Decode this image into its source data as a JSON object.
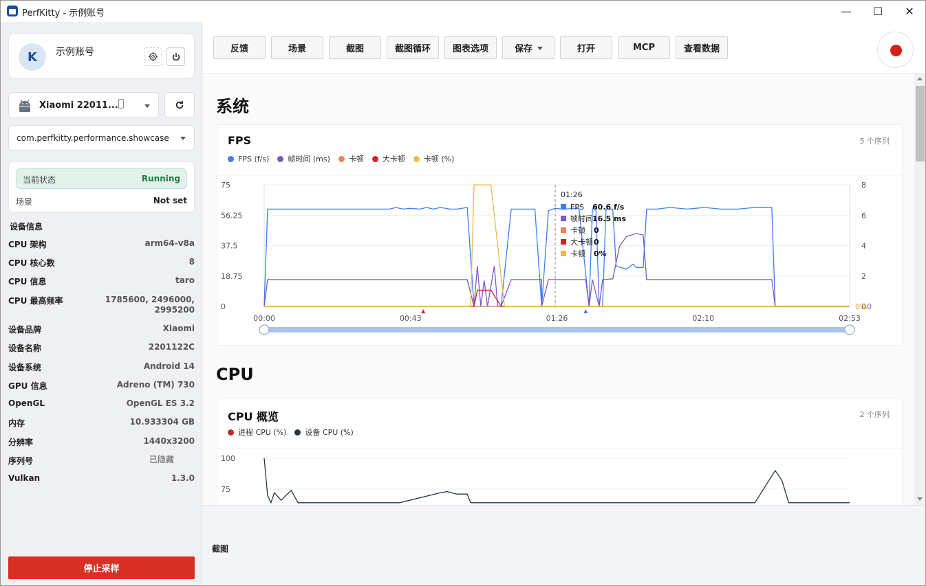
{
  "window": {
    "title": "PerfKitty - 示例账号",
    "minimize": "—",
    "maximize": "☐",
    "close": "✕"
  },
  "account": {
    "initial": "K",
    "name": "示例账号",
    "settings_icon": "gear-icon",
    "power_icon": "power-icon"
  },
  "device": {
    "name": "Xiaomi 22011...",
    "icon": "android-icon",
    "refresh_icon": "refresh-icon"
  },
  "package": {
    "name": "com.perfkitty.performance.showcase"
  },
  "status": {
    "label": "当前状态",
    "value": "Running",
    "scene_label": "场景",
    "scene_value": "Not set",
    "running_color": "#1e7d45"
  },
  "device_info": {
    "heading": "设备信息",
    "items": [
      {
        "key": "CPU 架构",
        "value": "arm64-v8a"
      },
      {
        "key": "CPU 核心数",
        "value": "8"
      },
      {
        "key": "CPU 信息",
        "value": "taro"
      },
      {
        "key": "CPU 最高频率",
        "value": "1785600, 2496000,",
        "value2": "2995200"
      },
      {
        "key": "设备品牌",
        "value": "Xiaomi"
      },
      {
        "key": "设备名称",
        "value": "2201122C"
      },
      {
        "key": "设备系统",
        "value": "Android 14"
      },
      {
        "key": "GPU 信息",
        "value": "Adreno (TM) 730"
      },
      {
        "key": "OpenGL",
        "value": "OpenGL ES 3.2"
      },
      {
        "key": "内存",
        "value": "10.933304 GB"
      },
      {
        "key": "分辨率",
        "value": "1440x3200"
      },
      {
        "key": "序列号",
        "value": "已隐藏"
      },
      {
        "key": "Vulkan",
        "value": "1.3.0"
      }
    ]
  },
  "stop_button": "停止采样",
  "toolbar": {
    "buttons": [
      "反馈",
      "场景",
      "截图",
      "截图循环",
      "图表选项",
      "保存",
      "打开",
      "MCP",
      "查看数据"
    ],
    "record_color": "#d91e18"
  },
  "sections": {
    "system": "系统",
    "cpu": "CPU"
  },
  "fps_chart": {
    "title": "FPS",
    "series_count": "5 个序列",
    "legend": [
      {
        "name": "FPS (f/s)",
        "color": "#3b7ef0"
      },
      {
        "name": "帧时间 (ms)",
        "color": "#7e57c2"
      },
      {
        "name": "卡顿",
        "color": "#e8845a"
      },
      {
        "name": "大卡顿",
        "color": "#d32028"
      },
      {
        "name": "卡顿 (%)",
        "color": "#f2b84b"
      }
    ],
    "y_ticks": [
      "75",
      "56.25",
      "37.5",
      "18.75",
      "0"
    ],
    "y2_ticks": [
      "8",
      "6",
      "4",
      "2",
      "0"
    ],
    "x_ticks": [
      "00:00",
      "00:43",
      "01:26",
      "02:10",
      "02:53"
    ],
    "right_edge_labels": [
      "0%",
      "0"
    ],
    "tooltip": {
      "time": "01:26",
      "rows": [
        {
          "name": "FPS",
          "value": "60.6 f/s",
          "color": "#3b7ef0"
        },
        {
          "name": "帧时间",
          "value": "16.5 ms",
          "color": "#7e57c2"
        },
        {
          "name": "卡顿",
          "value": "0",
          "color": "#e8845a"
        },
        {
          "name": "大卡顿",
          "value": "0",
          "color": "#d32028"
        },
        {
          "name": "卡顿",
          "value": "0%",
          "color": "#f2b84b"
        }
      ]
    }
  },
  "cpu_chart": {
    "title": "CPU 概览",
    "series_count": "2 个序列",
    "legend": [
      {
        "name": "进程 CPU (%)",
        "color": "#c62828"
      },
      {
        "name": "设备 CPU (%)",
        "color": "#263445"
      }
    ],
    "y_ticks": [
      "100",
      "75"
    ]
  },
  "bottom_panel": {
    "label": "截图"
  },
  "chart_data": [
    {
      "type": "line",
      "title": "FPS",
      "x_unit": "seconds",
      "xlim": [
        0,
        173
      ],
      "ylim": [
        0,
        75
      ],
      "y2lim": [
        0,
        8
      ],
      "series": [
        {
          "name": "FPS (f/s)",
          "axis": "left",
          "points": [
            [
              0,
              0
            ],
            [
              1,
              60
            ],
            [
              37,
              60
            ],
            [
              39,
              61
            ],
            [
              41,
              60
            ],
            [
              43,
              60.5
            ],
            [
              46,
              60
            ],
            [
              48,
              61
            ],
            [
              50,
              60
            ],
            [
              52,
              61
            ],
            [
              55,
              60
            ],
            [
              57,
              60
            ],
            [
              60,
              61
            ],
            [
              62,
              0
            ],
            [
              70,
              0
            ],
            [
              73,
              60
            ],
            [
              80,
              60
            ],
            [
              82,
              0
            ],
            [
              84,
              59
            ],
            [
              86,
              60.5
            ],
            [
              88,
              60
            ],
            [
              93,
              60.5
            ],
            [
              96,
              0
            ],
            [
              97,
              60
            ],
            [
              98,
              62
            ],
            [
              99,
              0
            ],
            [
              100,
              0
            ],
            [
              101,
              60
            ],
            [
              103,
              60
            ],
            [
              104,
              25
            ],
            [
              107,
              23
            ],
            [
              109,
              26
            ],
            [
              110,
              24
            ],
            [
              112,
              24
            ],
            [
              113,
              60
            ],
            [
              116,
              60
            ],
            [
              120,
              61
            ],
            [
              125,
              60
            ],
            [
              130,
              61
            ],
            [
              135,
              60
            ],
            [
              140,
              60
            ],
            [
              145,
              61
            ],
            [
              150,
              61
            ],
            [
              151,
              0
            ],
            [
              173,
              0
            ]
          ]
        },
        {
          "name": "帧时间 (ms)",
          "axis": "right",
          "points": [
            [
              0,
              0
            ],
            [
              1,
              16.5
            ],
            [
              60,
              16.5
            ],
            [
              62,
              0
            ],
            [
              63,
              25
            ],
            [
              64,
              0
            ],
            [
              65,
              16
            ],
            [
              66,
              0
            ],
            [
              68,
              25
            ],
            [
              69,
              0
            ],
            [
              70,
              0
            ],
            [
              73,
              16.5
            ],
            [
              82,
              16.5
            ],
            [
              82,
              0
            ],
            [
              84,
              16.5
            ],
            [
              95,
              16.5
            ],
            [
              96,
              0
            ],
            [
              97,
              16.5
            ],
            [
              99,
              0
            ],
            [
              100,
              16.5
            ],
            [
              103,
              17
            ],
            [
              105,
              37
            ],
            [
              107,
              43
            ],
            [
              110,
              45
            ],
            [
              112,
              44
            ],
            [
              113,
              16.5
            ],
            [
              150,
              16.5
            ],
            [
              151,
              0
            ],
            [
              173,
              0
            ]
          ]
        },
        {
          "name": "卡顿",
          "axis": "right",
          "points": [
            [
              0,
              0
            ],
            [
              173,
              0
            ]
          ]
        },
        {
          "name": "大卡顿",
          "axis": "right",
          "points": [
            [
              0,
              0
            ],
            [
              62,
              0
            ],
            [
              63,
              10
            ],
            [
              67,
              10
            ],
            [
              70,
              0
            ],
            [
              173,
              0
            ]
          ]
        },
        {
          "name": "卡顿 (%)",
          "axis": "right",
          "points": [
            [
              0,
              0
            ],
            [
              61,
              0
            ],
            [
              62,
              75
            ],
            [
              67,
              75
            ],
            [
              71,
              0
            ],
            [
              173,
              0
            ]
          ]
        }
      ],
      "markers": [
        {
          "x": 47,
          "color": "#d32028"
        },
        {
          "x": 95,
          "color": "#3b7ef0"
        }
      ],
      "cursor_x": 86
    },
    {
      "type": "line",
      "title": "CPU 概览",
      "x_unit": "seconds",
      "xlim": [
        0,
        173
      ],
      "ylim_visible": [
        64,
        100
      ],
      "series": [
        {
          "name": "进程 CPU (%)",
          "points": []
        },
        {
          "name": "设备 CPU (%)",
          "points": [
            [
              0,
              100
            ],
            [
              1,
              70
            ],
            [
              2,
              64
            ],
            [
              3,
              72
            ],
            [
              5,
              66
            ],
            [
              8,
              74
            ],
            [
              10,
              64
            ],
            [
              20,
              64
            ],
            [
              40,
              64
            ],
            [
              52,
              72
            ],
            [
              54,
              73
            ],
            [
              57,
              71
            ],
            [
              60,
              71
            ],
            [
              61,
              64
            ],
            [
              100,
              64
            ],
            [
              145,
              64
            ],
            [
              151,
              90
            ],
            [
              153,
              82
            ],
            [
              155,
              64
            ],
            [
              173,
              64
            ]
          ]
        }
      ]
    }
  ]
}
